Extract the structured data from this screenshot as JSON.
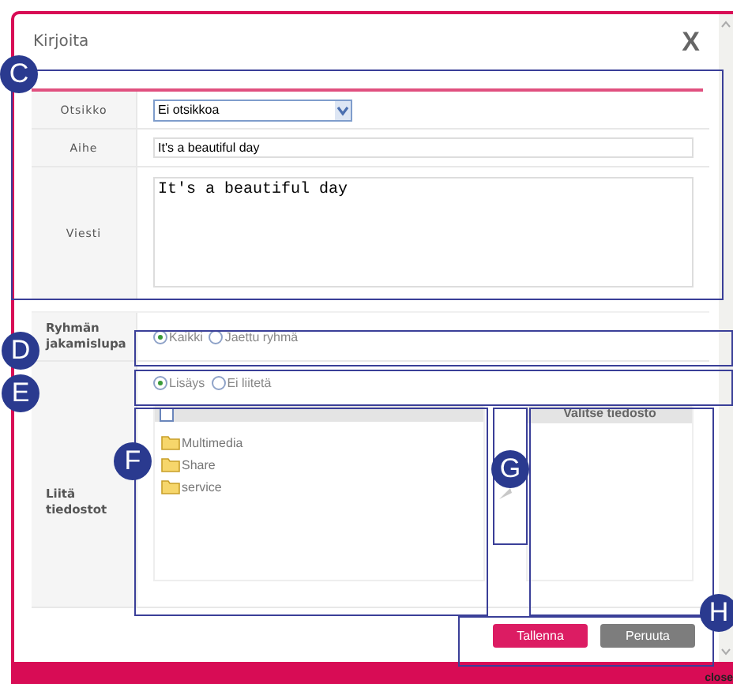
{
  "dialog": {
    "title": "Kirjoita",
    "close": "X"
  },
  "subject": {
    "label": "Otsikko",
    "value": "Ei otsikkoa"
  },
  "topic": {
    "label": "Aihe",
    "value": "It's a beautiful day"
  },
  "message": {
    "label": "Viesti",
    "value": "It's a beautiful day"
  },
  "sharing": {
    "label": "Ryhmän jakamislupa",
    "options": [
      {
        "label": "Kaikki",
        "selected": true
      },
      {
        "label": "Jaettu ryhmä",
        "selected": false
      }
    ]
  },
  "attach_mode": {
    "options": [
      {
        "label": "Lisäys",
        "selected": true
      },
      {
        "label": "Ei liitetä",
        "selected": false
      }
    ]
  },
  "attachments": {
    "label": "Liitä tiedostot",
    "select_all_checked": false,
    "folders": [
      {
        "name": "Multimedia"
      },
      {
        "name": "Share"
      },
      {
        "name": "service"
      }
    ],
    "selected_title": "Valitse tiedosto"
  },
  "buttons": [
    {
      "label": "Tallenna",
      "kind": "primary"
    },
    {
      "label": "Peruuta",
      "kind": "secondary"
    }
  ],
  "footer": "close",
  "annotations": [
    {
      "kind": "marker",
      "label": "C"
    },
    {
      "kind": "marker",
      "label": "D"
    },
    {
      "kind": "marker",
      "label": "E"
    },
    {
      "kind": "marker",
      "label": "F"
    },
    {
      "kind": "marker",
      "label": "G"
    },
    {
      "kind": "box"
    },
    {
      "kind": "marker",
      "label": "H"
    }
  ]
}
